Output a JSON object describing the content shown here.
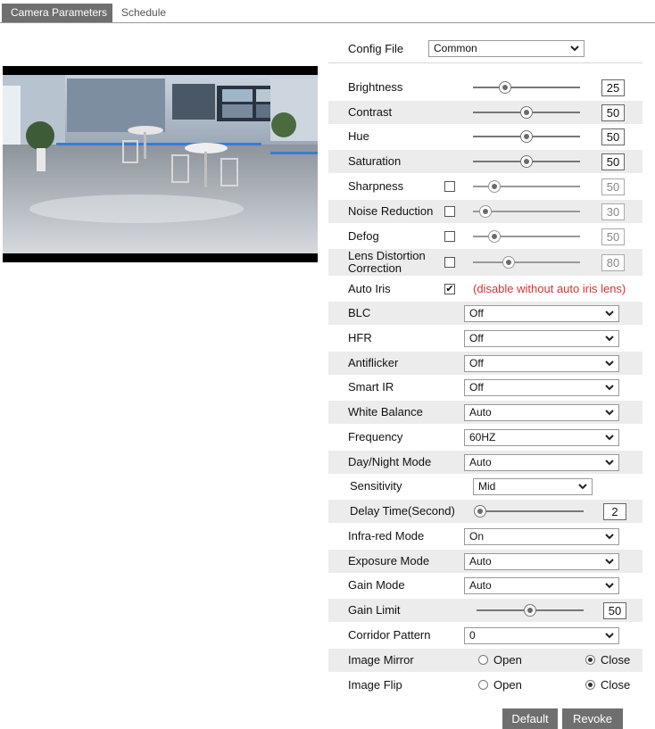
{
  "tabs": [
    {
      "label": "Camera Parameters",
      "active": true
    },
    {
      "label": "Schedule",
      "active": false
    }
  ],
  "config_file": {
    "label": "Config File",
    "value": "Common"
  },
  "sliders": {
    "brightness": {
      "label": "Brightness",
      "value": "25",
      "fraction": 0.3
    },
    "contrast": {
      "label": "Contrast",
      "value": "50",
      "fraction": 0.5
    },
    "hue": {
      "label": "Hue",
      "value": "50",
      "fraction": 0.5
    },
    "saturation": {
      "label": "Saturation",
      "value": "50",
      "fraction": 0.5
    },
    "sharpness": {
      "label": "Sharpness",
      "value": "50",
      "fraction": 0.2,
      "checked": false
    },
    "noise_reduction": {
      "label": "Noise Reduction",
      "value": "30",
      "fraction": 0.12,
      "checked": false
    },
    "defog": {
      "label": "Defog",
      "value": "50",
      "fraction": 0.2,
      "checked": false
    },
    "lens_distortion": {
      "label_line1": "Lens Distortion",
      "label_line2": "Correction",
      "value": "80",
      "fraction": 0.33,
      "checked": false
    },
    "delay_time": {
      "label": "Delay Time(Second)",
      "value": "2",
      "fraction": 0.03
    },
    "gain_limit": {
      "label": "Gain Limit",
      "value": "50",
      "fraction": 0.5
    }
  },
  "auto_iris": {
    "label": "Auto Iris",
    "checked": true,
    "note": "(disable without auto iris lens)"
  },
  "selects": {
    "blc": {
      "label": "BLC",
      "value": "Off"
    },
    "hfr": {
      "label": "HFR",
      "value": "Off"
    },
    "antiflicker": {
      "label": "Antiflicker",
      "value": "Off"
    },
    "smart_ir": {
      "label": "Smart IR",
      "value": "Off"
    },
    "white_balance": {
      "label": "White Balance",
      "value": "Auto"
    },
    "frequency": {
      "label": "Frequency",
      "value": "60HZ"
    },
    "day_night": {
      "label": "Day/Night Mode",
      "value": "Auto"
    },
    "sensitivity": {
      "label": "Sensitivity",
      "value": "Mid"
    },
    "infra_red": {
      "label": "Infra-red Mode",
      "value": "On"
    },
    "exposure": {
      "label": "Exposure Mode",
      "value": "Auto"
    },
    "gain_mode": {
      "label": "Gain Mode",
      "value": "Auto"
    },
    "corridor": {
      "label": "Corridor Pattern",
      "value": "0"
    }
  },
  "radios": {
    "image_mirror": {
      "label": "Image Mirror",
      "open": "Open",
      "close": "Close",
      "selected": "Close"
    },
    "image_flip": {
      "label": "Image Flip",
      "open": "Open",
      "close": "Close",
      "selected": "Close"
    }
  },
  "buttons": {
    "default": "Default",
    "revoke": "Revoke"
  },
  "icons": {
    "dropdown": "chevron-down-icon",
    "checkmark": "✔"
  },
  "colors": {
    "tab_active": "#6f6f6f",
    "warning": "#e03030",
    "row_shade": "#ececec"
  }
}
